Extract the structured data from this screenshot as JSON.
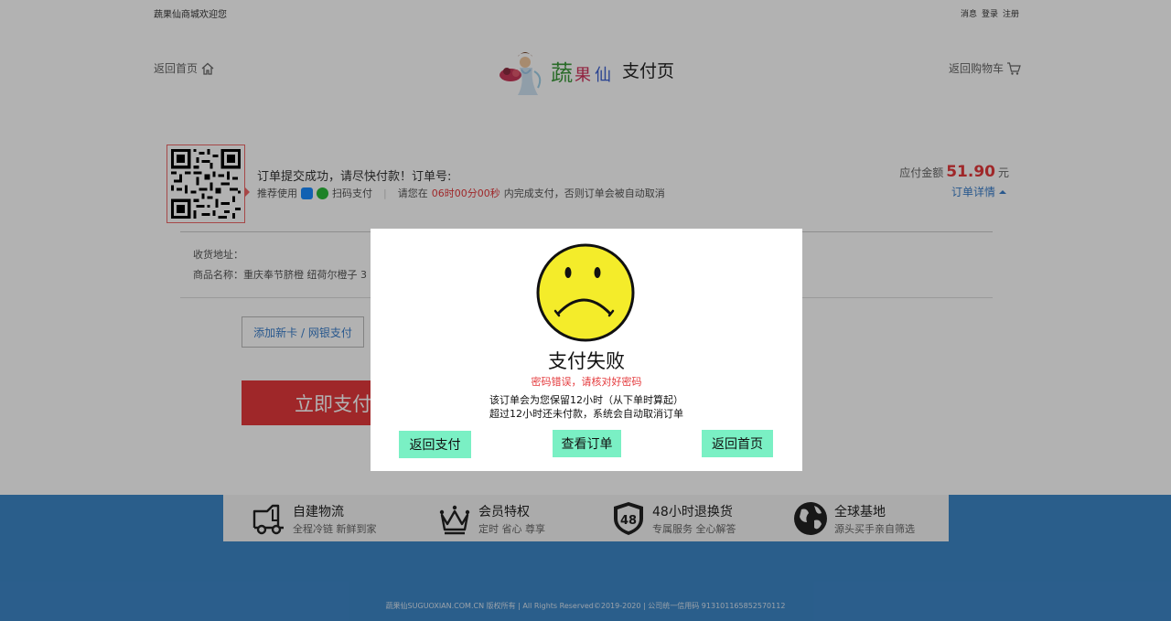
{
  "topbar": {
    "welcome": "蔬果仙商城欢迎您",
    "links": [
      "消息",
      "登录",
      "注册"
    ]
  },
  "header": {
    "back_home": "返回首页",
    "page_name": "支付页",
    "back_cart": "返回购物车"
  },
  "order": {
    "message": "订单提交成功，请尽快付款！订单号:",
    "recommend": "推荐使用",
    "scan_pay": "扫码支付",
    "deadline_prefix": "请您在",
    "countdown": "06时00分00秒",
    "deadline_suffix": "内完成支付，否则订单会被自动取消",
    "amount_label": "应付金额",
    "amount_value": "51.90",
    "amount_unit": "元",
    "detail_link": "订单详情",
    "address_label": "收货地址：",
    "goods_label": "商品名称：",
    "goods_name": "重庆奉节脐橙 纽荷尔橙子 3"
  },
  "payment": {
    "add_card": "添加新卡 / 网银支付",
    "pay_now": "立即支付"
  },
  "modal": {
    "title": "支付失败",
    "error": "密码错误，请核对好密码",
    "line1": "该订单会为您保留12小时（从下单时算起）",
    "line2": "超过12小时还未付款，系统会自动取消订单",
    "btn_back_pay": "返回支付",
    "btn_view_order": "查看订单",
    "btn_back_home": "返回首页"
  },
  "services": [
    {
      "title": "自建物流",
      "desc": "全程冷链 新鲜到家",
      "icon": "truck-icon"
    },
    {
      "title": "会员特权",
      "desc": "定时 省心 尊享",
      "icon": "crown-icon"
    },
    {
      "title": "48小时退换货",
      "desc": "专属服务 全心解答",
      "icon": "shield-48-icon"
    },
    {
      "title": "全球基地",
      "desc": "源头买手亲自筛选",
      "icon": "globe-icon"
    }
  ],
  "footer": {
    "copyright": "蔬果仙SUGUOXIAN.COM.CN 版权所有 | All Rights Reserved©2019-2020 | 公司统一信用码 913101165852570112"
  },
  "colors": {
    "accent_red": "#e4393c",
    "link_blue": "#3a7ecb",
    "footer_blue": "#3d87c8",
    "modal_button": "#7af0c4",
    "face_yellow": "#f4ec2a"
  }
}
